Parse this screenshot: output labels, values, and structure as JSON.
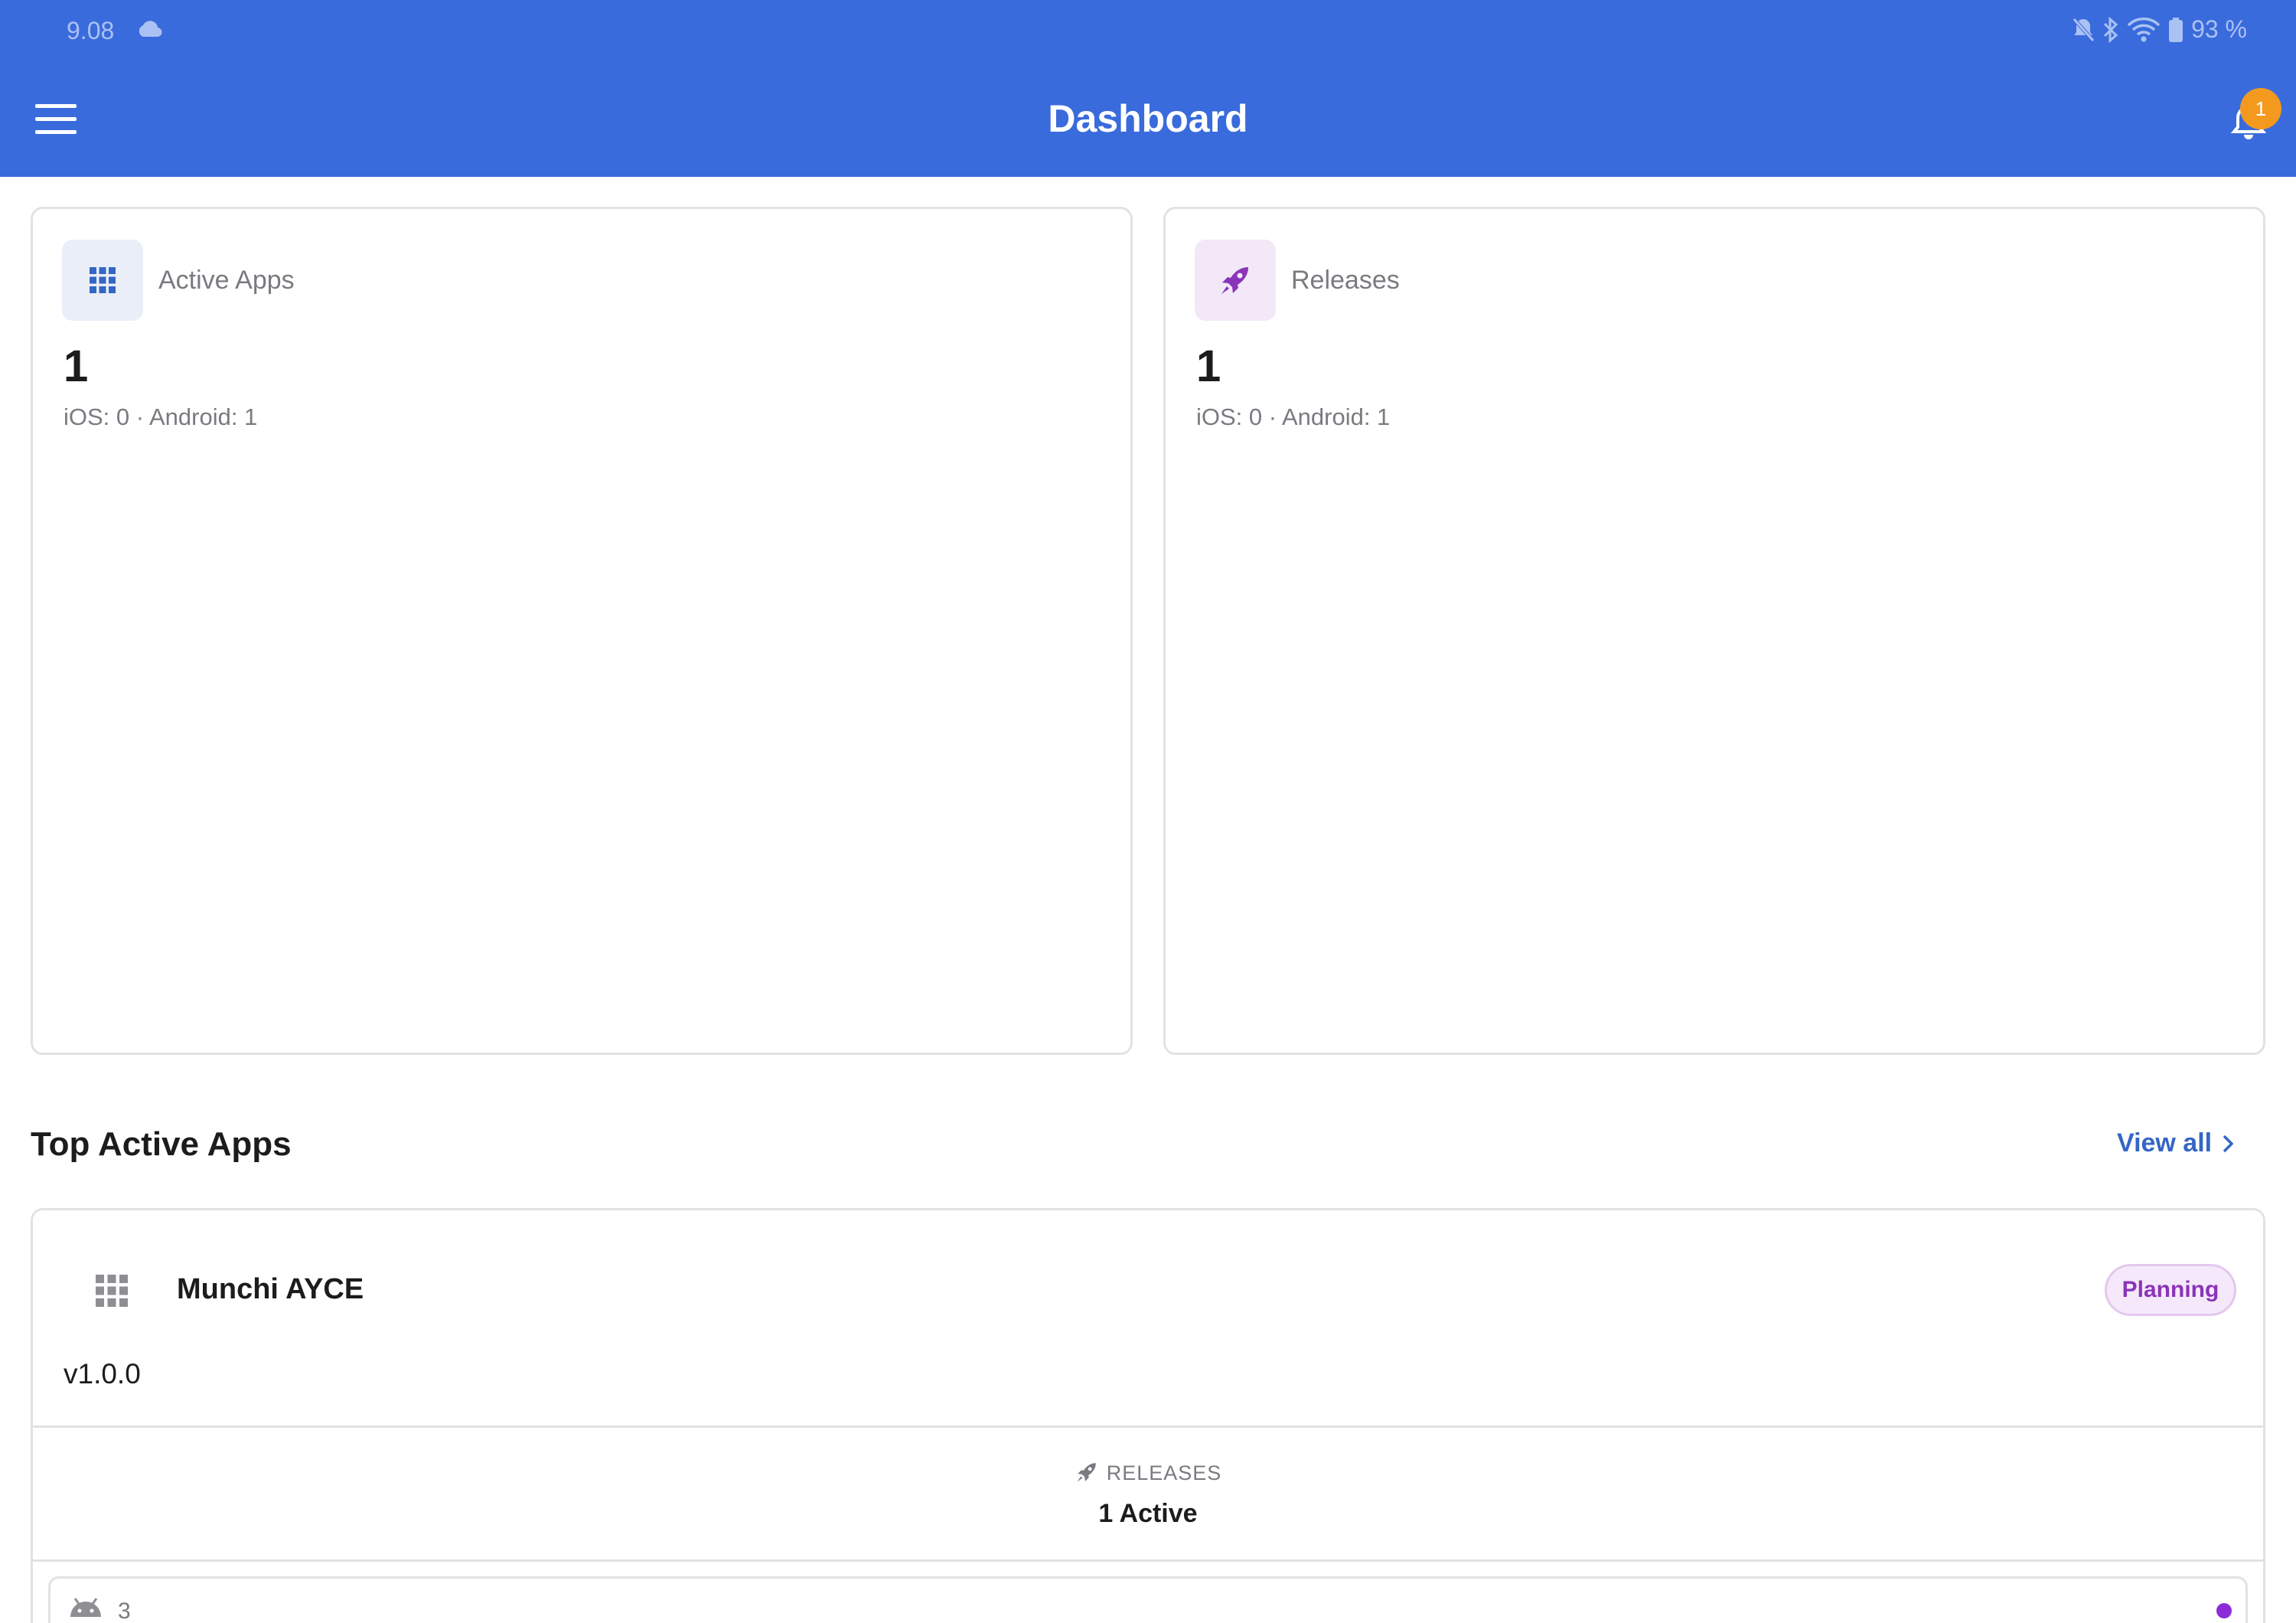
{
  "status_bar": {
    "time": "9.08",
    "battery": "93 %"
  },
  "header": {
    "title": "Dashboard",
    "notification_count": "1"
  },
  "stats": {
    "active_apps": {
      "label": "Active Apps",
      "value": "1",
      "breakdown": "iOS: 0 · Android: 1",
      "icon": "grid-icon"
    },
    "releases": {
      "label": "Releases",
      "value": "1",
      "breakdown": "iOS: 0 · Android: 1",
      "icon": "rocket-icon"
    }
  },
  "top_apps": {
    "title": "Top Active Apps",
    "view_all_label": "View all",
    "apps": [
      {
        "name": "Munchi AYCE",
        "status": "Planning",
        "version": "v1.0.0",
        "releases_label": "RELEASES",
        "releases_count": "1 Active",
        "platform_icon": "android-icon",
        "platform_count": "3"
      }
    ]
  },
  "colors": {
    "header_bg": "#3a6bdc",
    "badge": "#f39a1e",
    "accent_link": "#3466c4",
    "status_planning": "#8a34b8"
  }
}
